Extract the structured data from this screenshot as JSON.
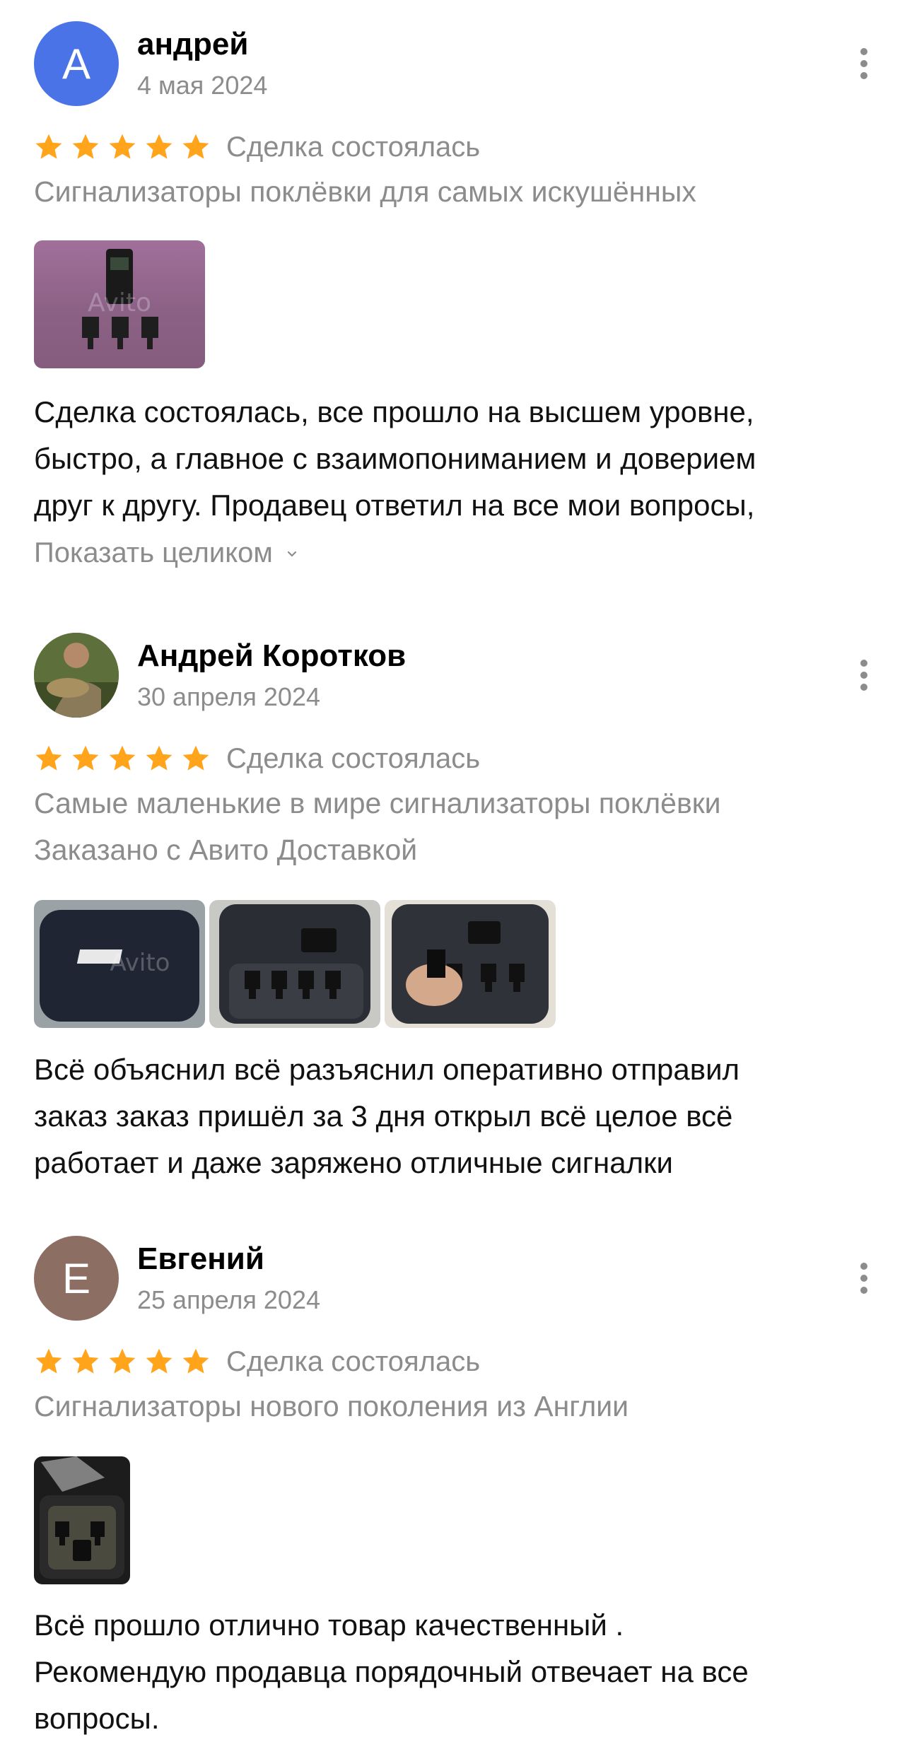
{
  "reviews": [
    {
      "name": "андрей",
      "date": "4 мая 2024",
      "avatar_letter": "А",
      "avatar_color": "#4a73e8",
      "rating": 5,
      "deal_status": "Сделка состоялась",
      "item_title": "Сигнализаторы поклёвки для самых искушённых",
      "delivery_note": "",
      "text_lines": [
        "Сделка состоялась, все прошло на высшем уровне,",
        "быстро, а главное с взаимопониманием и доверием",
        "друг к другу. Продавец ответил на все мои вопросы,"
      ],
      "show_more_label": "Показать целиком",
      "photos": [
        "photo-alarm-set-pink"
      ]
    },
    {
      "name": "Андрей Коротков",
      "date": "30 апреля 2024",
      "avatar_letter": "",
      "avatar_color": "",
      "rating": 5,
      "deal_status": "Сделка состоялась",
      "item_title": "Самые маленькие в мире сигнализаторы поклёвки",
      "delivery_note": "Заказано с Авито Доставкой",
      "text_lines": [
        "Всё объяснил всё разъяснил оперативно отправил",
        "заказ заказ пришёл за 3 дня открыл всё целое всё",
        "работает и даже заряжено отличные сигналки"
      ],
      "photos": [
        "photo-case-closed",
        "photo-case-open",
        "photo-alarm-in-hand"
      ]
    },
    {
      "name": "Евгений",
      "date": "25 апреля 2024",
      "avatar_letter": "Е",
      "avatar_color": "#8d6e63",
      "rating": 5,
      "deal_status": "Сделка состоялась",
      "item_title": "Сигнализаторы нового поколения из Англии",
      "delivery_note": "",
      "text_lines": [
        "Всё прошло отлично товар качественный .",
        "Рекомендую продавца порядочный отвечает на все",
        "вопросы."
      ],
      "photos": [
        "photo-box-set"
      ]
    }
  ],
  "watermark": "Avito",
  "colors": {
    "star": "#ffa41b",
    "secondary_text": "#8c8c8c",
    "body_text": "#111111"
  }
}
